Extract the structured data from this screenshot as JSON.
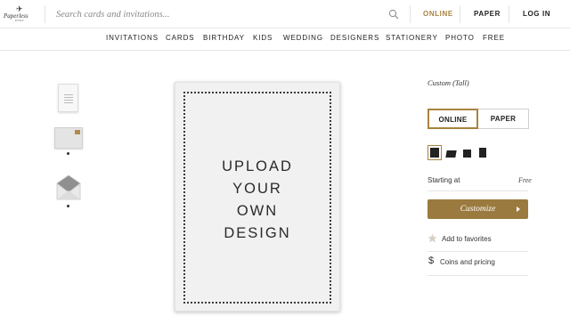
{
  "header": {
    "logo_main": "Paperless",
    "logo_sub": "POST",
    "search_placeholder": "Search cards and invitations...",
    "links": [
      {
        "label": "ONLINE",
        "active": true
      },
      {
        "label": "PAPER",
        "active": false
      },
      {
        "label": "LOG IN",
        "active": false
      }
    ]
  },
  "categories": [
    "INVITATIONS",
    "CARDS",
    "BIRTHDAY",
    "KIDS",
    "WEDDING",
    "DESIGNERS",
    "STATIONERY",
    "PHOTO",
    "FREE"
  ],
  "thumbnails": [
    {
      "name": "card"
    },
    {
      "name": "envelope"
    },
    {
      "name": "envelope-liner"
    }
  ],
  "preview": {
    "lines": [
      "UPLOAD",
      "YOUR",
      "OWN",
      "DESIGN"
    ]
  },
  "product": {
    "name": "Custom (Tall)",
    "format_options": [
      "ONLINE",
      "PAPER"
    ],
    "selected_format": "ONLINE",
    "price_label": "Starting at",
    "price_value": "Free",
    "customize_label": "Customize",
    "favorites_label": "Add to favorites",
    "coins_label": "Coins and pricing",
    "coins_symbol": "$"
  },
  "colors": {
    "accent": "#a8833e",
    "button": "#9b7a3f"
  }
}
